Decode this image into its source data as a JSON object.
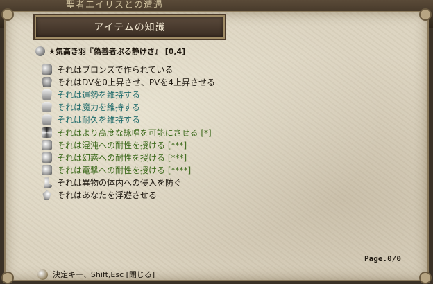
{
  "background": {
    "partial_text": "聖者エイリスとの遭遇"
  },
  "window": {
    "title": "アイテムの知識",
    "item_name": "★気高き羽『偽善者ぶる静けさ』 [0,4]",
    "lines": [
      {
        "icon": "orb-icon",
        "text": "それはブロンズで作られている",
        "color": "dark"
      },
      {
        "icon": "armor-icon",
        "text": "それはDVを0上昇させ、PVを4上昇させる",
        "color": "dark"
      },
      {
        "icon": "vest-icon",
        "text": "それは運勢を維持する",
        "color": "teal"
      },
      {
        "icon": "vest-icon",
        "text": "それは魔力を維持する",
        "color": "teal"
      },
      {
        "icon": "vest-icon",
        "text": "それは耐久を維持する",
        "color": "teal"
      },
      {
        "icon": "spiral-icon",
        "text": "それはより高度な詠唱を可能にさせる [*]",
        "color": "green"
      },
      {
        "icon": "shield-icon",
        "text": "それは混沌への耐性を授ける [***]",
        "color": "green"
      },
      {
        "icon": "shield-icon",
        "text": "それは幻惑への耐性を授ける [***]",
        "color": "green"
      },
      {
        "icon": "shield-icon",
        "text": "それは電撃への耐性を授ける [****]",
        "color": "green"
      },
      {
        "icon": "foot-icon",
        "text": "それは異物の体内への侵入を防ぐ",
        "color": "dark"
      },
      {
        "icon": "feather-icon",
        "text": "それはあなたを浮遊させる",
        "color": "dark"
      }
    ],
    "page": "Page.0/0",
    "footer_hint": "決定キー、Shift,Esc [閉じる]"
  },
  "colors": {
    "dark": "#1e1810",
    "teal": "#1f6b6b",
    "green": "#3d6a1c",
    "parchment": "#ddd5c2",
    "title_bar": "#3a2d22"
  }
}
